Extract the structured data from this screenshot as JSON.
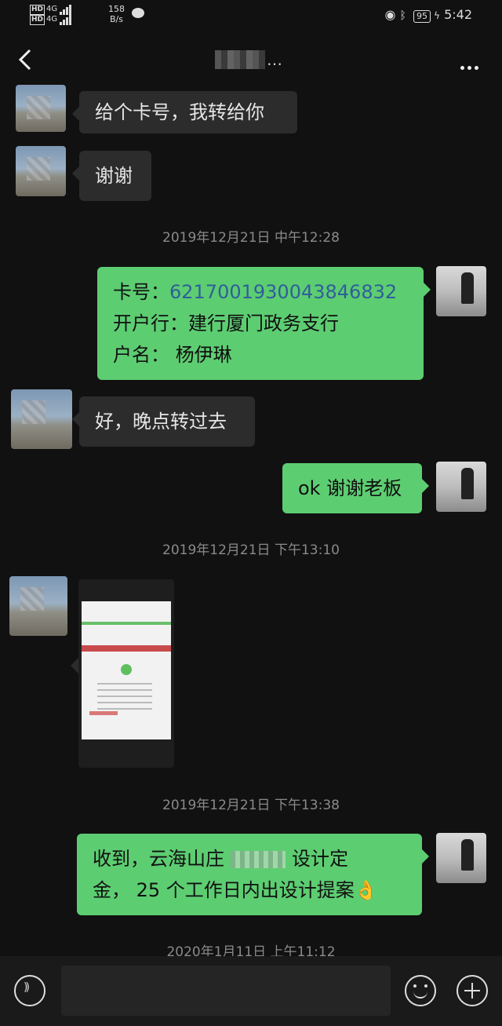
{
  "status_bar": {
    "hd1": "HD",
    "hd2": "HD",
    "net1": "4G",
    "net2": "4G",
    "speed_value": "158",
    "speed_unit": "B/s",
    "battery": "95",
    "time": "5:42",
    "icons": [
      "message-icon",
      "eye-icon",
      "bluetooth-icon",
      "battery-icon"
    ]
  },
  "nav": {
    "title_suffix": "…",
    "icons": [
      "back-arrow-icon",
      "more-dots-icon"
    ]
  },
  "messages": [
    {
      "side": "in",
      "text": "给个卡号，我转给你"
    },
    {
      "side": "in",
      "text": "谢谢"
    },
    {
      "side": "out",
      "card_label": "卡号：",
      "card_number": "6217001930043846832",
      "bank_line": "开户行：建行厦门政务支行",
      "name_line": "户名：  杨伊琳"
    },
    {
      "side": "in",
      "text": "好，晚点转过去"
    },
    {
      "side": "out",
      "text": "ok 谢谢老板"
    },
    {
      "side": "in",
      "type": "image"
    },
    {
      "side": "out",
      "line1": "收到，云海山庄",
      "line1b": "设计定",
      "line2": "金， 25 个工作日内出设计提案👌"
    }
  ],
  "timestamps": [
    "2019年12月21日 中午12:28",
    "2019年12月21日 下午13:10",
    "2019年12月21日 下午13:38",
    "2020年1月11日 上午11:12"
  ],
  "input_bar": {
    "icons": [
      "voice-icon",
      "emoji-icon",
      "plus-icon"
    ]
  },
  "colors": {
    "background": "#111111",
    "incoming_bubble": "#2c2c2c",
    "outgoing_bubble": "#5dcd72",
    "card_number": "#2f5f9a"
  }
}
